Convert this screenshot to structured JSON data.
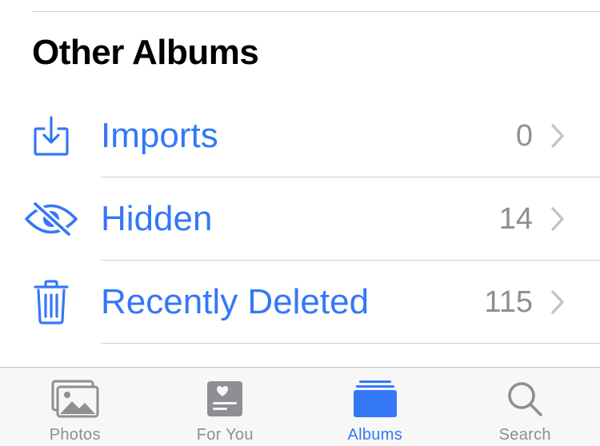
{
  "section": {
    "title": "Other Albums"
  },
  "albums": [
    {
      "label": "Imports",
      "count": "0",
      "icon": "import-icon"
    },
    {
      "label": "Hidden",
      "count": "14",
      "icon": "eye-slash-icon"
    },
    {
      "label": "Recently Deleted",
      "count": "115",
      "icon": "trash-icon"
    }
  ],
  "tab_bar": {
    "tabs": [
      {
        "label": "Photos",
        "icon": "photos-icon",
        "active": false
      },
      {
        "label": "For You",
        "icon": "for-you-icon",
        "active": false
      },
      {
        "label": "Albums",
        "icon": "albums-icon",
        "active": true
      },
      {
        "label": "Search",
        "icon": "search-icon",
        "active": false
      }
    ]
  },
  "colors": {
    "accent": "#3478f6",
    "secondary_text": "#8e8e93",
    "chevron": "#c4c4c7",
    "divider": "#d1d1d6",
    "tab_bar_bg": "#f7f7f7"
  }
}
